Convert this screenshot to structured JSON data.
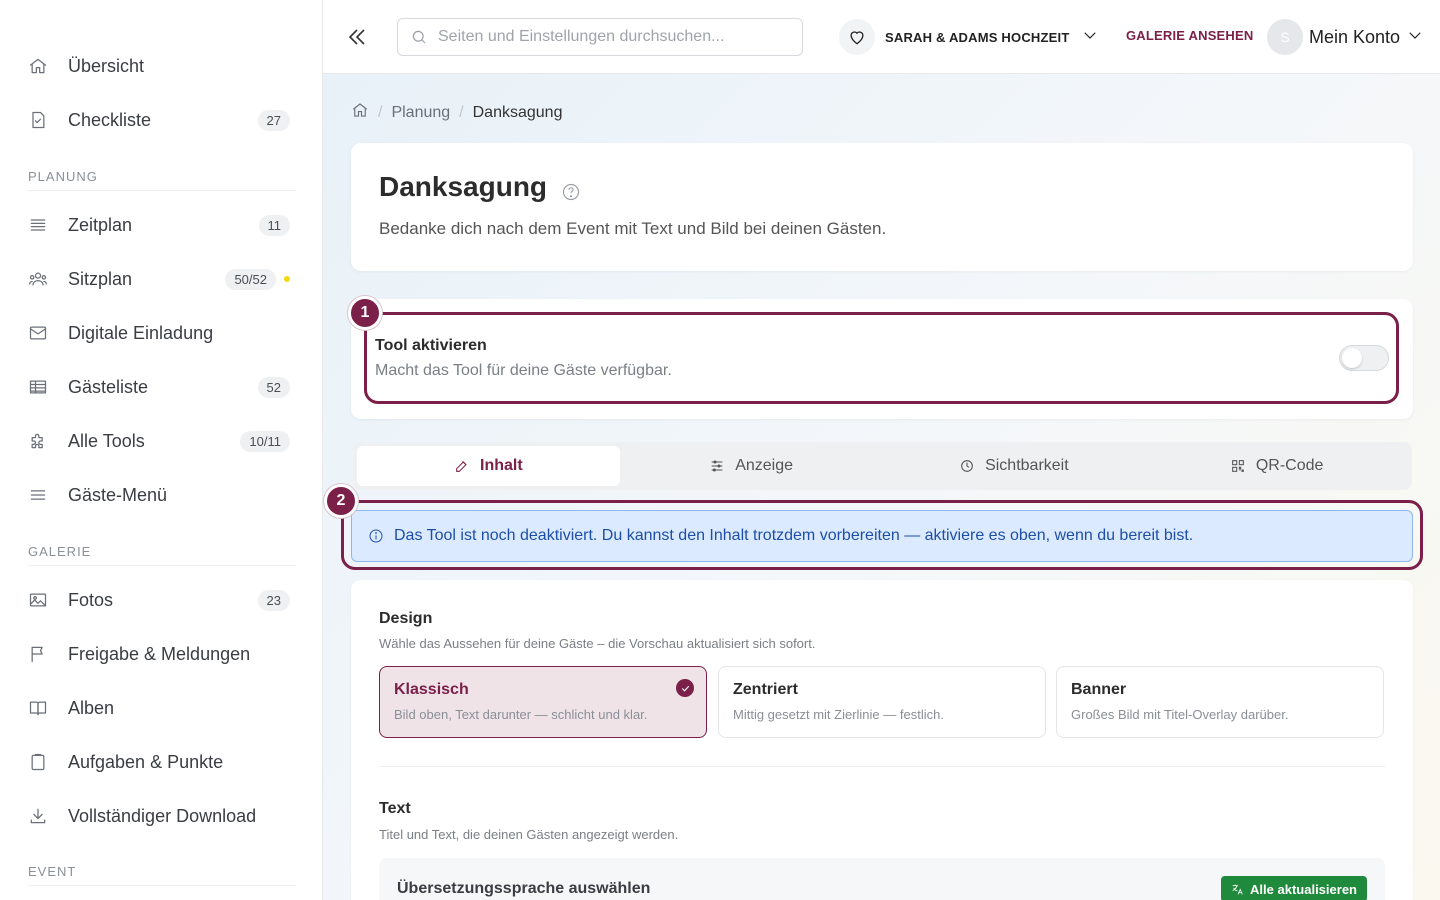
{
  "sidebar": {
    "items_top": [
      {
        "label": "Übersicht",
        "icon": "home-icon"
      },
      {
        "label": "Checkliste",
        "icon": "checklist-icon",
        "badge": "27"
      }
    ],
    "sections": [
      {
        "title": "PLANUNG"
      },
      {
        "title": "GALERIE"
      },
      {
        "title": "EVENT"
      }
    ],
    "planung": [
      {
        "label": "Zeitplan",
        "badge": "11"
      },
      {
        "label": "Sitzplan",
        "badge": "50/52"
      },
      {
        "label": "Digitale Einladung"
      },
      {
        "label": "Gästeliste",
        "badge": "52"
      },
      {
        "label": "Alle Tools",
        "badge": "10/11"
      },
      {
        "label": "Gäste-Menü"
      }
    ],
    "galerie": [
      {
        "label": "Fotos",
        "badge": "23"
      },
      {
        "label": "Freigabe & Meldungen"
      },
      {
        "label": "Alben"
      },
      {
        "label": "Aufgaben & Punkte"
      },
      {
        "label": "Vollständiger Download"
      }
    ]
  },
  "topbar": {
    "search_placeholder": "Seiten und Einstellungen durchsuchen...",
    "event_name": "SARAH & ADAMS HOCHZEIT",
    "gallery_link": "GALERIE ANSEHEN",
    "avatar_initial": "S",
    "account_label": "Mein Konto"
  },
  "breadcrumb": {
    "items": [
      "Planung",
      "Danksagung"
    ]
  },
  "page": {
    "title": "Danksagung",
    "subtitle": "Bedanke dich nach dem Event mit Text und Bild bei deinen Gästen."
  },
  "tool_toggle": {
    "step": "1",
    "title": "Tool aktivieren",
    "description": "Macht das Tool für deine Gäste verfügbar.",
    "enabled": false
  },
  "tabs": [
    {
      "label": "Inhalt",
      "active": true
    },
    {
      "label": "Anzeige"
    },
    {
      "label": "Sichtbarkeit"
    },
    {
      "label": "QR-Code"
    }
  ],
  "info": {
    "step": "2",
    "text": "Das Tool ist noch deaktiviert. Du kannst den Inhalt trotzdem vorbereiten — aktiviere es oben, wenn du bereit bist."
  },
  "design": {
    "title": "Design",
    "description": "Wähle das Aussehen für deine Gäste – die Vorschau aktualisiert sich sofort.",
    "options": [
      {
        "title": "Klassisch",
        "desc": "Bild oben, Text darunter — schlicht und klar.",
        "selected": true
      },
      {
        "title": "Zentriert",
        "desc": "Mittig gesetzt mit Zierlinie — festlich."
      },
      {
        "title": "Banner",
        "desc": "Großes Bild mit Titel-Overlay darüber."
      }
    ]
  },
  "text_section": {
    "title": "Text",
    "description": "Titel und Text, die deinen Gästen angezeigt werden.",
    "language_label": "Übersetzungssprache auswählen",
    "update_all": "Alle aktualisieren"
  },
  "colors": {
    "accent": "#7b2149",
    "info_bg": "#dbeafe",
    "info_text": "#1e4fa8",
    "success": "#1f8a3b",
    "status_dot": "#f5d90a"
  }
}
